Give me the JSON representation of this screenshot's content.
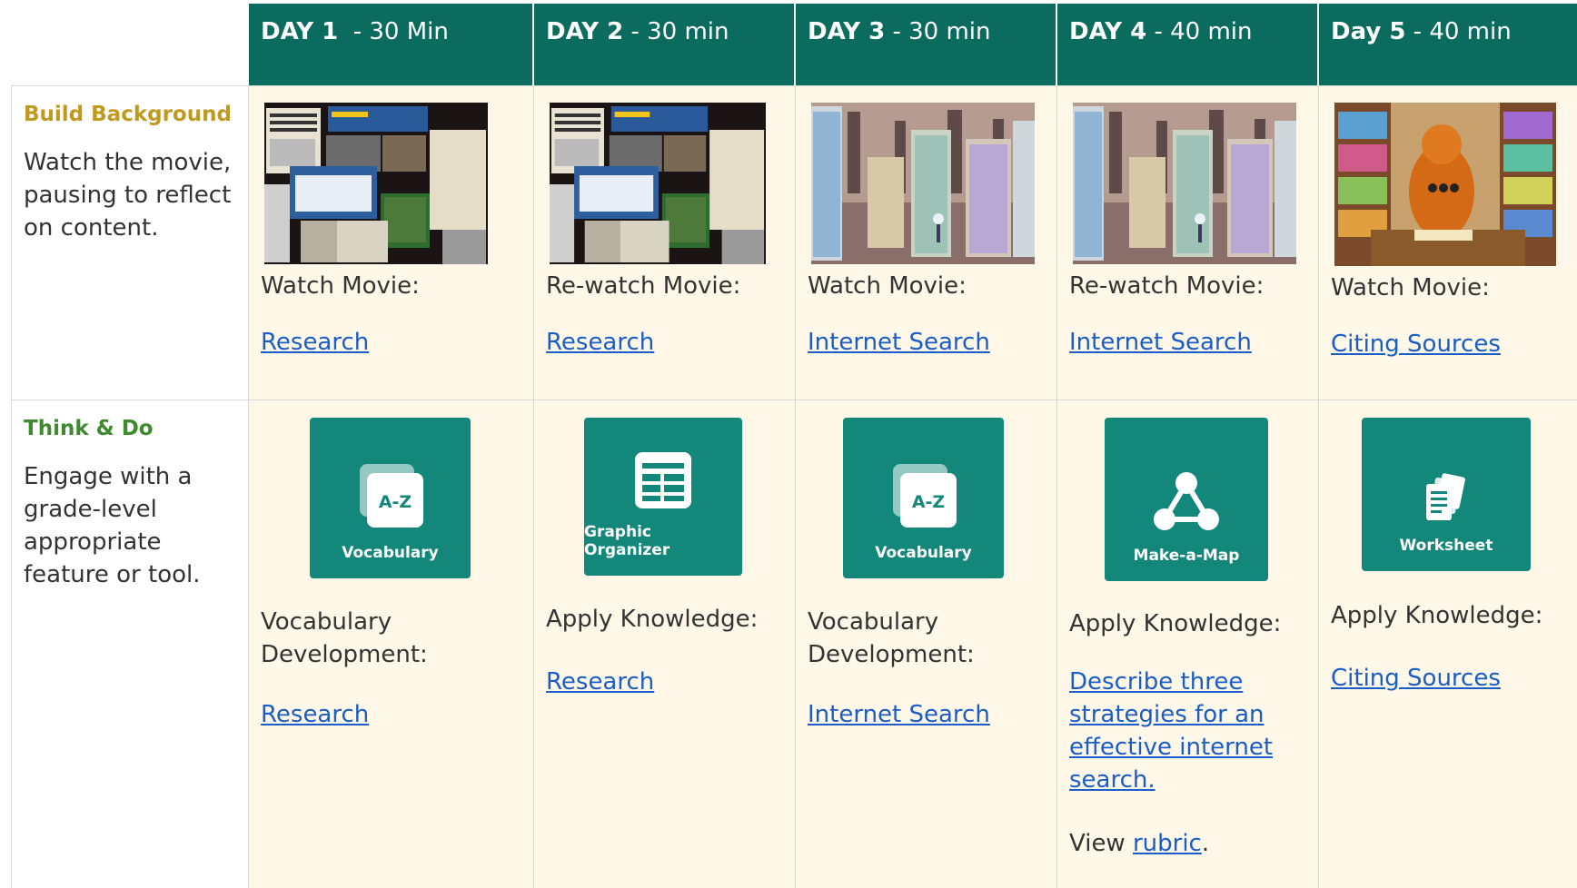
{
  "header": {
    "days": [
      {
        "bold": "DAY 1",
        "rest": "  - 30 Min"
      },
      {
        "bold": "DAY 2",
        "rest": " - 30 min"
      },
      {
        "bold": "DAY 3",
        "rest": " - 30 min"
      },
      {
        "bold": "DAY 4",
        "rest": " - 40 min"
      },
      {
        "bold": "Day 5",
        "rest": " - 40 min"
      }
    ]
  },
  "colors": {
    "header_bg": "#0b6b5e",
    "cell_bg": "#fff8e8",
    "tile_bg": "#13877a",
    "build_label": "#c09a1e",
    "think_label": "#3f8a2e",
    "link": "#1a5dc9"
  },
  "rows": {
    "build": {
      "title": "Build Background",
      "description": "Watch the movie, pausing to reflect on content.",
      "cells": [
        {
          "thumb": "research-movie-thumbnail",
          "text": "Watch Movie:",
          "link": "Research"
        },
        {
          "thumb": "research-movie-thumbnail",
          "text": "Re-watch Movie:",
          "link": "Research"
        },
        {
          "thumb": "internet-search-movie-thumbnail",
          "text": "Watch Movie:",
          "link": "Internet Search"
        },
        {
          "thumb": "internet-search-movie-thumbnail",
          "text": "Re-watch Movie:",
          "link": "Internet Search"
        },
        {
          "thumb": "citing-sources-movie-thumbnail",
          "text": "Watch Movie:",
          "link": "Citing Sources"
        }
      ]
    },
    "think": {
      "title": "Think & Do",
      "description": "Engage with a grade-level appropriate feature or tool.",
      "cells": [
        {
          "tile_icon": "vocabulary-icon",
          "tile_label": "Vocabulary",
          "text": "Vocabulary Development:",
          "link": "Research"
        },
        {
          "tile_icon": "graphic-organizer-icon",
          "tile_label": "Graphic Organizer",
          "text": "Apply Knowledge:",
          "link": "Research"
        },
        {
          "tile_icon": "vocabulary-icon",
          "tile_label": "Vocabulary",
          "text": "Vocabulary Development:",
          "link": "Internet Search"
        },
        {
          "tile_icon": "make-a-map-icon",
          "tile_label": "Make-a-Map",
          "text": "Apply Knowledge:",
          "link": "Describe three strategies for an effective internet search.",
          "extra_prefix": "View ",
          "extra_link": "rubric",
          "extra_suffix": "."
        },
        {
          "tile_icon": "worksheet-icon",
          "tile_label": "Worksheet",
          "text": "Apply Knowledge:",
          "link": "Citing Sources"
        }
      ]
    }
  }
}
